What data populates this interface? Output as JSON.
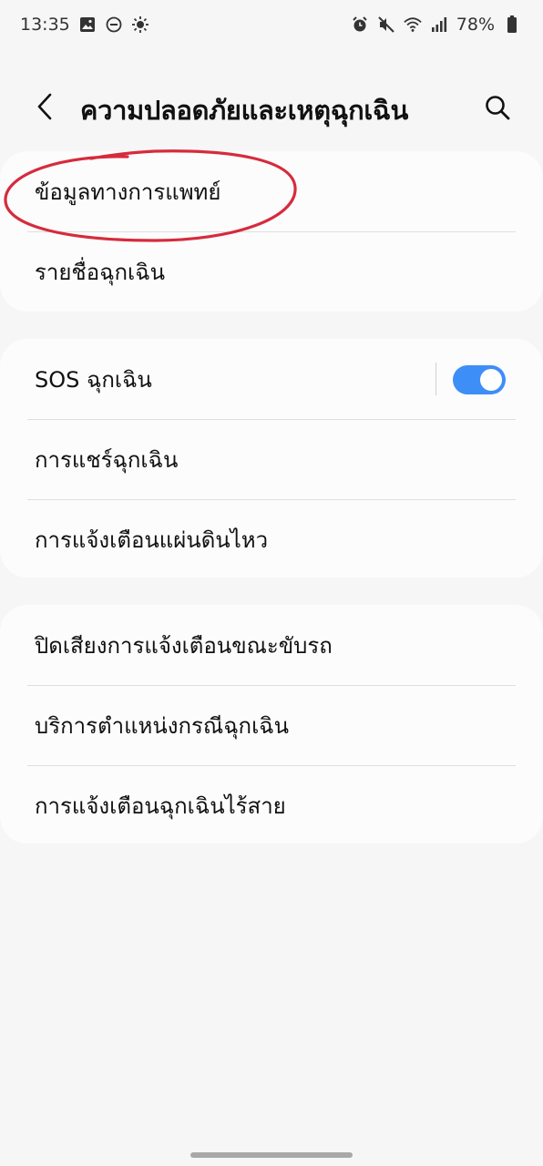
{
  "status_bar": {
    "time": "13:35",
    "battery": "78%",
    "icons_left": [
      "gallery-icon",
      "dnd-icon",
      "brightness-icon"
    ],
    "icons_right": [
      "alarm-icon",
      "mute-icon",
      "wifi-icon",
      "signal-icon",
      "battery-icon"
    ]
  },
  "header": {
    "title": "ความปลอดภัยและเหตุฉุกเฉิน",
    "back_icon": "chevron-left-icon",
    "search_icon": "search-icon"
  },
  "groups": [
    {
      "items": [
        {
          "label": "ข้อมูลทางการแพทย์"
        },
        {
          "label": "รายชื่อฉุกเฉิน"
        }
      ]
    },
    {
      "items": [
        {
          "label": "SOS ฉุกเฉิน",
          "toggle": true
        },
        {
          "label": "การแชร์ฉุกเฉิน"
        },
        {
          "label": "การแจ้งเตือนแผ่นดินไหว"
        }
      ]
    },
    {
      "items": [
        {
          "label": "ปิดเสียงการแจ้งเตือนขณะขับรถ"
        },
        {
          "label": "บริการตำแหน่งกรณีฉุกเฉิน"
        },
        {
          "label": "การแจ้งเตือนฉุกเฉินไร้สาย"
        }
      ]
    }
  ],
  "colors": {
    "accent": "#3e8ef7",
    "annotation": "#d62b3c",
    "background": "#f6f6f6",
    "card": "#fcfcfc"
  }
}
